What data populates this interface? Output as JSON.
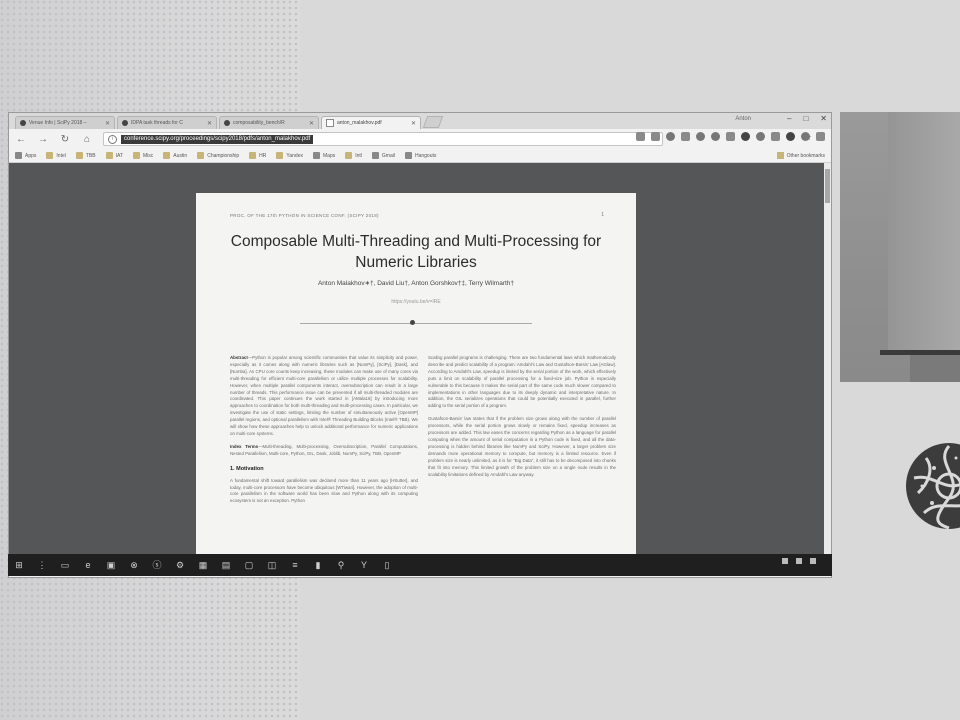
{
  "browser": {
    "tabs": [
      {
        "label": "Venue Info | SciPy 2018 –",
        "icon": "page-icon",
        "active": false
      },
      {
        "label": "IDPA task threads for C",
        "icon": "github-icon",
        "active": false
      },
      {
        "label": "composability_bench/R",
        "icon": "github-icon",
        "active": false
      },
      {
        "label": "anton_malakhov.pdf",
        "icon": "document-icon",
        "active": true
      }
    ],
    "user": "Anton",
    "window_controls": {
      "minimize": "–",
      "maximize": "□",
      "close": "✕"
    },
    "address": {
      "url": "conference.scipy.org/proceedings/scipy2018/pdfs/anton_malakhov.pdf"
    },
    "bookmarks": [
      {
        "label": "Apps",
        "icon": "apps-icon"
      },
      {
        "label": "Intel",
        "icon": "folder-icon"
      },
      {
        "label": "TBB",
        "icon": "folder-icon"
      },
      {
        "label": "IAT",
        "icon": "folder-icon"
      },
      {
        "label": "Misc",
        "icon": "folder-icon"
      },
      {
        "label": "Austin",
        "icon": "folder-icon"
      },
      {
        "label": "Championship",
        "icon": "folder-icon"
      },
      {
        "label": "HR",
        "icon": "folder-icon"
      },
      {
        "label": "Yandex",
        "icon": "folder-icon"
      },
      {
        "label": "Maps",
        "icon": "maps-icon"
      },
      {
        "label": "Intl",
        "icon": "folder-icon"
      },
      {
        "label": "Gmail",
        "icon": "gmail-icon"
      },
      {
        "label": "Hangouts",
        "icon": "hangouts-icon"
      }
    ],
    "other_bookmarks": "Other bookmarks"
  },
  "pdf": {
    "running_head": "PROC. OF THE 17th PYTHON IN SCIENCE CONF. (SCIPY 2018)",
    "page_number": "1",
    "title": "Composable Multi-Threading and Multi-Processing for Numeric Libraries",
    "authors": "Anton Malakhov∗†, David Liu†, Anton Gorshkov†‡, Terry Wilmarth†",
    "orcid": "https://youtu.be/v=IRE",
    "abstract_label": "Abstract",
    "abstract_text": "—Python is popular among scientific communities that value its simplicity and power, especially as it comes along with numeric libraries such as [NumPy], [SciPy], [Dask], and [Numba]. As CPU core counts keep increasing, these modules can make use of many cores via multi-threading for efficient multi-core parallelism or utilize multiple processes for scalability. However, when multiple parallel components interact, oversubscription can result in a large number of threads. This performance issue can be prevented if all multi-threaded modules are coordinated. This paper continues the work started in [AMala16] by introducing more approaches to coordination for both multi-threading and multi-processing cases. In particular, we investigate the use of static settings, limiting the number of simultaneously active [OpenMP] parallel regions, and optional parallelism with Intel® Threading Building Blocks (Intel® TBB). We will show how these approaches help to unlock additional performance for numeric applications on multi-core systems.",
    "index_label": "Index Terms",
    "index_text": "—Multi-threading, Multi-processing, Oversubscription, Parallel Computations, Nested Parallelism, Multi-core, Python, GIL, Dask, Joblib, NumPy, SciPy, TBB, OpenMP",
    "section1_heading": "1. Motivation",
    "section1_text": "A fundamental shift toward parallelism was declared more than 11 years ago [HSutter], and today, multi-core processors have become ubiquitous [WTiwari]. However, the adoption of multi-core parallelism in the software world has been slow and Python along with its computing ecosystem is not an exception. Python",
    "right_p1": "Scaling parallel programs is challenging. There are two fundamental laws which mathematically describe and predict scalability of a program: Amdahl's Law and Gustafson-Barsis' Law [AGlaw]. According to Amdahl's Law, speedup is limited by the serial portion of the work, which effectively puts a limit on scalability of parallel processing for a fixed-size job. Python is especially vulnerable to this because it makes the serial part of the same code much slower compared to implementations in other languages due to its deeply dynamic and interpretative nature. In addition, the GIL serializes operations that could be potentially executed in parallel, further adding to the serial portion of a program.",
    "right_p2": "Gustafson-Barsis' law states that if the problem size grows along with the number of parallel processors, while the serial portion grows slowly or remains fixed, speedup increases as processors are added. This law eases the concerns regarding Python as a language for parallel computing when the amount of serial computation in a Python code is fixed, and all the data-processing is hidden behind libraries like NumPy and SciPy. However, a larger problem size demands more operational memory to compute, but memory is a limited resource. Even if problem size is nearly unlimited, as it is for \"Big Data\", it still has to be decomposed into chunks that fit into memory. This limited growth of the problem size on a single node results in the scalability limitations defined by Amdahl's Law anyway."
  },
  "taskbar": {
    "icons": [
      "windows-start-icon",
      "cortana-icon",
      "file-explorer-icon",
      "edge-icon",
      "store-icon",
      "xbox-icon",
      "skype-icon",
      "settings-icon",
      "calculator-icon",
      "notepad-icon",
      "cmd-icon",
      "python-icon",
      "vscode-icon",
      "terminal-icon"
    ],
    "clock": ""
  },
  "colors": {
    "viewer_bg": "#555658",
    "page_bg": "#f4f4f3",
    "taskbar_bg": "#1f1f1f",
    "url_highlight": "#3a3a3a"
  }
}
